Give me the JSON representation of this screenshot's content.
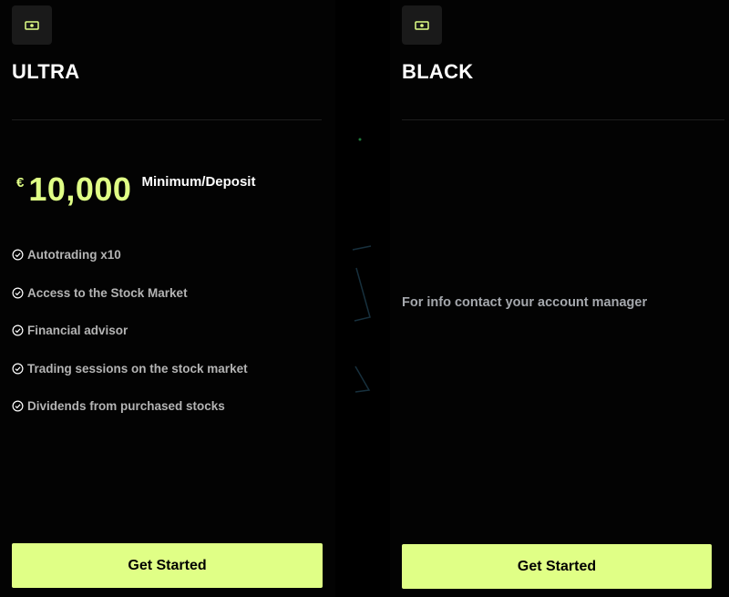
{
  "colors": {
    "accent": "#e0ff86",
    "background": "#000000",
    "feature_text": "#b4b4b4",
    "info_text": "#a5a8ad"
  },
  "plans": [
    {
      "icon": "banknote-icon",
      "title": "ULTRA",
      "price": {
        "currency": "€",
        "amount": "10,000",
        "caption": "Minimum/Deposit"
      },
      "features": [
        "Autotrading x10",
        "Access to the Stock Market",
        "Financial advisor",
        "Trading sessions on the stock market",
        "Dividends from purchased stocks"
      ],
      "feature_icon": "check-circle-icon",
      "cta_label": "Get Started"
    },
    {
      "icon": "banknote-icon",
      "title": "BLACK",
      "info": "For info contact your account manager",
      "cta_label": "Get Started"
    }
  ]
}
